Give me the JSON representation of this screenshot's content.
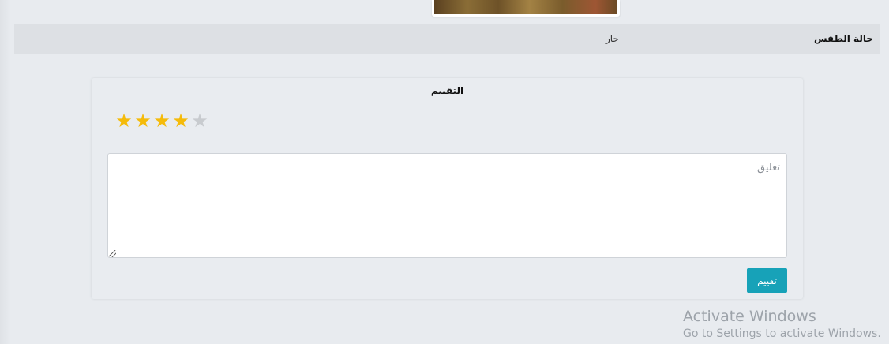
{
  "info_row": {
    "label": "حالة الطقس",
    "value": "حار"
  },
  "rating": {
    "title": "التقييم",
    "score": 4,
    "max": 5,
    "star_glyph": "★",
    "filled_color": "#f5bb0a",
    "empty_color": "#c8cbcf"
  },
  "comment": {
    "placeholder": "تعليق",
    "value": ""
  },
  "submit": {
    "label": "تقييم",
    "color": "#17a2b8"
  },
  "watermark": {
    "title": "Activate Windows",
    "subtitle": "Go to Settings to activate Windows."
  }
}
